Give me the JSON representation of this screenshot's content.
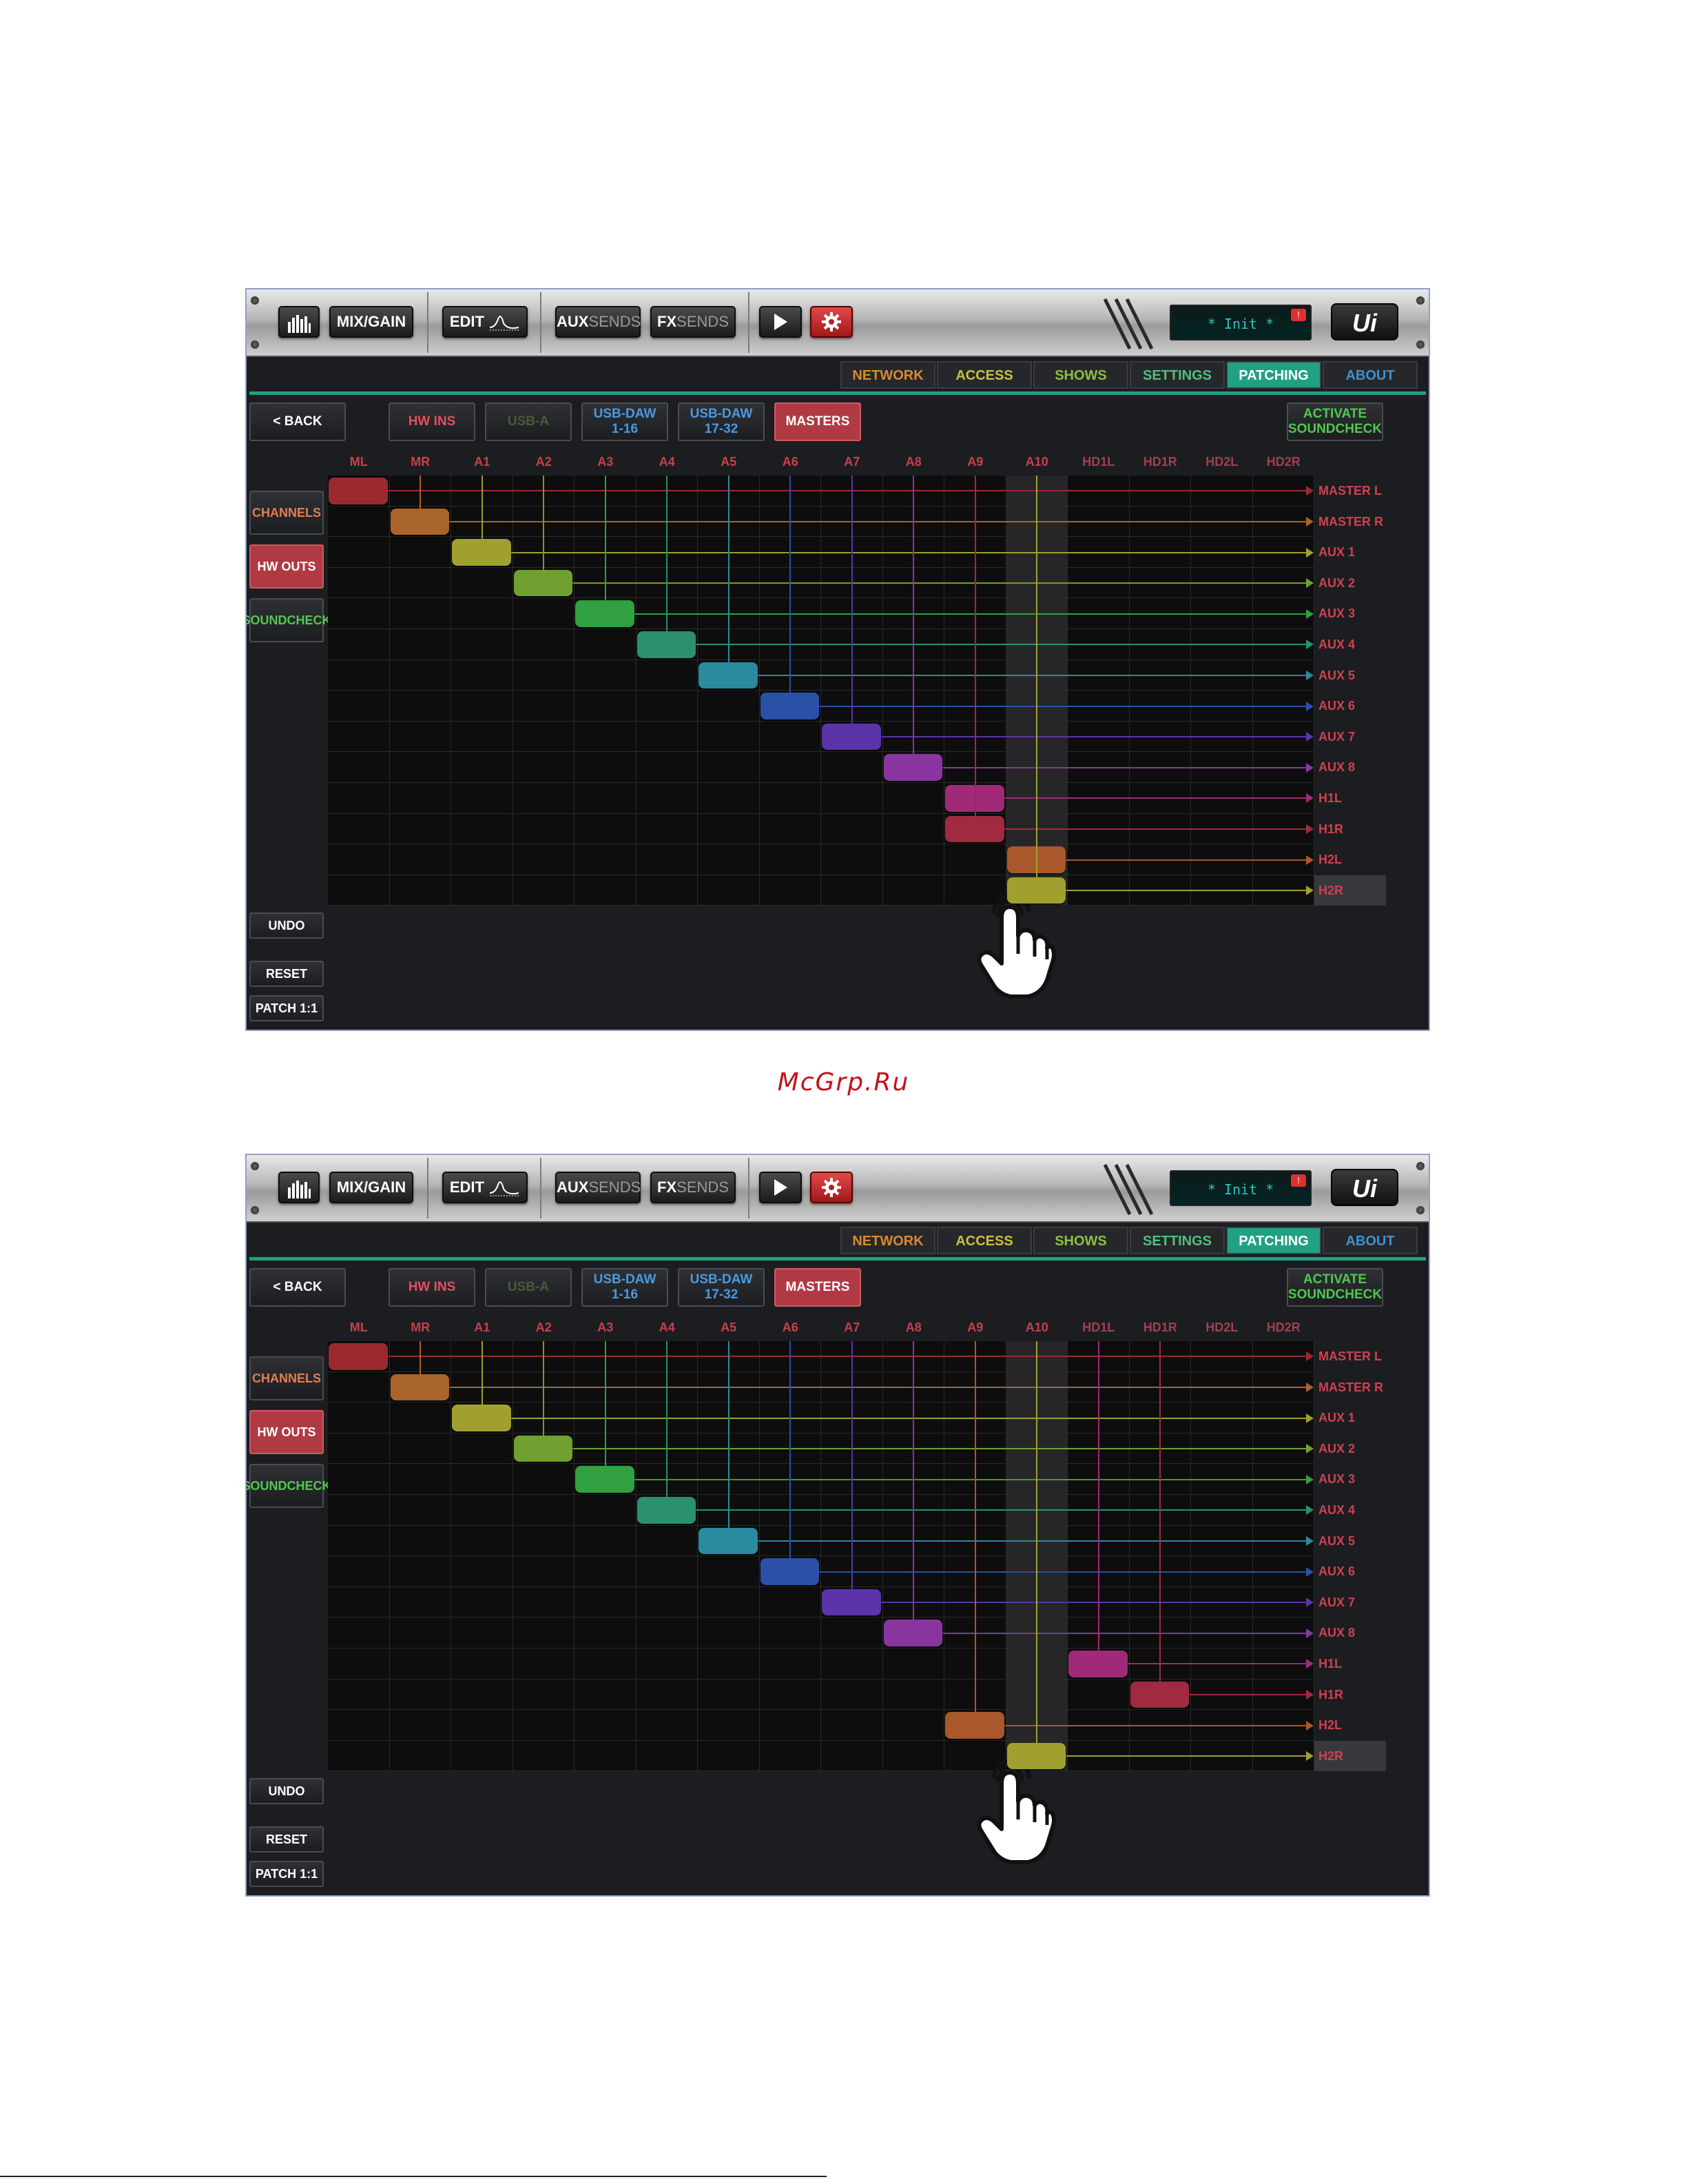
{
  "toolbar": {
    "mix_gain": "MIX/GAIN",
    "edit": "EDIT",
    "aux_a": "AUX",
    "aux_b": "SENDS",
    "fx_a": "FX",
    "fx_b": "SENDS",
    "display": "* Init *",
    "badge": "!",
    "logo": "Ui"
  },
  "tabs": [
    {
      "label": "NETWORK",
      "color": "#d88a30"
    },
    {
      "label": "ACCESS",
      "color": "#c9c040"
    },
    {
      "label": "SHOWS",
      "color": "#8ac040"
    },
    {
      "label": "SETTINGS",
      "color": "#50c080"
    },
    {
      "label": "PATCHING",
      "color": "#ffffff"
    },
    {
      "label": "ABOUT",
      "color": "#4090d0"
    }
  ],
  "patch": {
    "back": "< BACK",
    "hw_ins": "HW INS",
    "usb_a": "USB-A",
    "usb_daw_1": "USB-DAW\n1-16",
    "usb_daw_2": "USB-DAW\n17-32",
    "masters": "MASTERS",
    "activate": "ACTIVATE\nSOUNDCHECK"
  },
  "side": {
    "channels": "CHANNELS",
    "hw_outs": "HW OUTS",
    "soundcheck": "SOUNDCHECK",
    "undo": "UNDO",
    "reset": "RESET",
    "patch11": "PATCH 1:1"
  },
  "columns": [
    "ML",
    "MR",
    "A1",
    "A2",
    "A3",
    "A4",
    "A5",
    "A6",
    "A7",
    "A8",
    "A9",
    "A10",
    "HD1L",
    "HD1R",
    "HD2L",
    "HD2R"
  ],
  "rows": [
    "MASTER L",
    "MASTER R",
    "AUX 1",
    "AUX 2",
    "AUX 3",
    "AUX 4",
    "AUX 5",
    "AUX 6",
    "AUX 7",
    "AUX 8",
    "H1L",
    "H1R",
    "H2L",
    "H2R"
  ],
  "row_colors": [
    "#9a2a30",
    "#a8642a",
    "#a0a030",
    "#70a030",
    "#30a040",
    "#2a9070",
    "#2a8aa0",
    "#2a50a8",
    "#5a34a8",
    "#8a34a0",
    "#a02a78",
    "#a02a40",
    "#a8582a",
    "#a0a030"
  ],
  "screens": [
    {
      "patch_cols": [
        0,
        1,
        2,
        3,
        4,
        5,
        6,
        7,
        8,
        9,
        10,
        10,
        11,
        11
      ]
    },
    {
      "patch_cols": [
        0,
        1,
        2,
        3,
        4,
        5,
        6,
        7,
        8,
        9,
        12,
        13,
        10,
        11
      ]
    }
  ],
  "watermark": "McGrp.Ru"
}
